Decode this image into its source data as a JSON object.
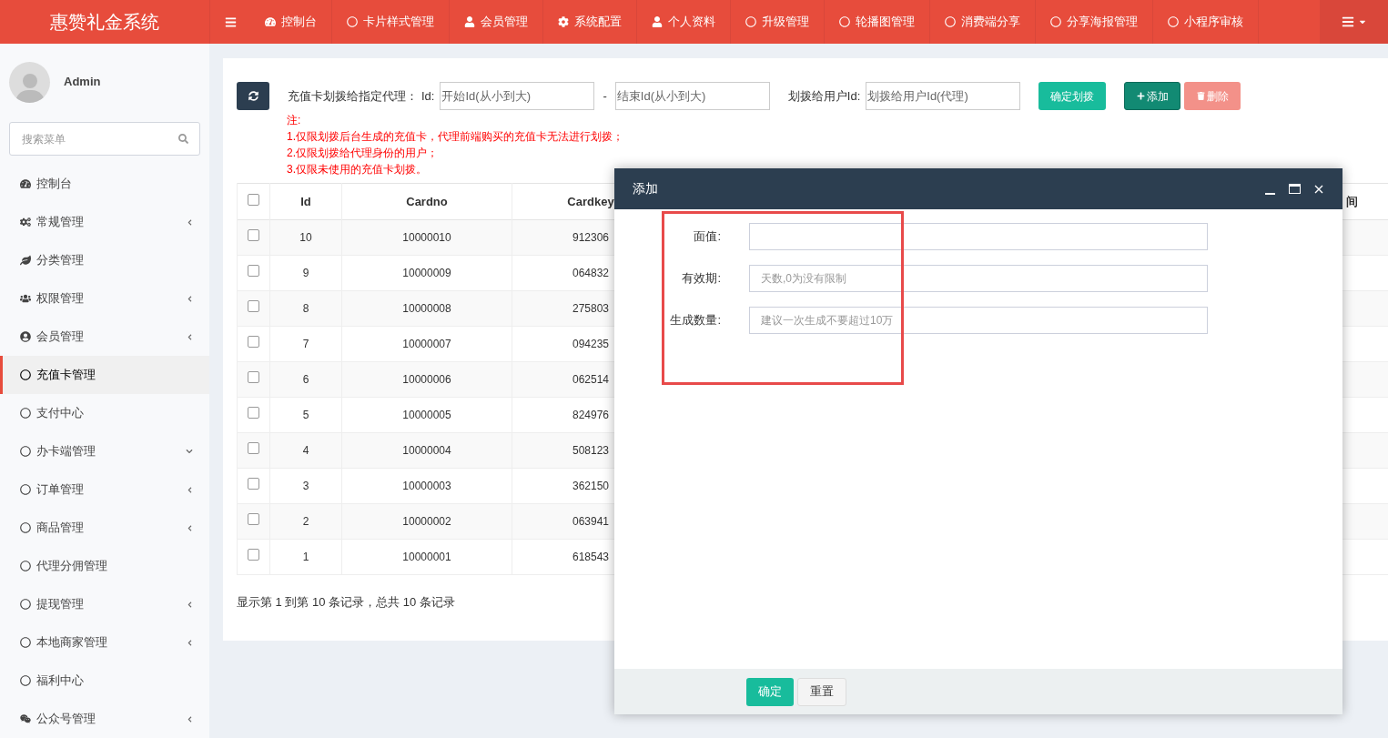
{
  "app_title": "惠赞礼金系统",
  "top_nav": [
    {
      "label": "控制台"
    },
    {
      "label": "卡片样式管理"
    },
    {
      "label": "会员管理"
    },
    {
      "label": "系统配置"
    },
    {
      "label": "个人资料"
    },
    {
      "label": "升级管理"
    },
    {
      "label": "轮播图管理"
    },
    {
      "label": "消费端分享"
    },
    {
      "label": "分享海报管理"
    },
    {
      "label": "小程序审核"
    }
  ],
  "user": {
    "name": "Admin"
  },
  "sidebar_search": {
    "placeholder": "搜索菜单"
  },
  "sidebar": {
    "items": [
      {
        "label": "控制台",
        "selected": false
      },
      {
        "label": "常规管理",
        "selected": false,
        "expanded": false
      },
      {
        "label": "分类管理",
        "selected": false
      },
      {
        "label": "权限管理",
        "selected": false,
        "expanded": false
      },
      {
        "label": "会员管理",
        "selected": false,
        "expanded": false
      },
      {
        "label": "充值卡管理",
        "selected": true
      },
      {
        "label": "支付中心",
        "selected": false
      },
      {
        "label": "办卡端管理",
        "selected": false,
        "expanded": true
      },
      {
        "label": "订单管理",
        "selected": false,
        "expanded": false
      },
      {
        "label": "商品管理",
        "selected": false,
        "expanded": false
      },
      {
        "label": "代理分佣管理",
        "selected": false
      },
      {
        "label": "提现管理",
        "selected": false,
        "expanded": false
      },
      {
        "label": "本地商家管理",
        "selected": false,
        "expanded": false
      },
      {
        "label": "福利中心",
        "selected": false
      },
      {
        "label": "公众号管理",
        "selected": false,
        "expanded": false
      }
    ]
  },
  "toolbar": {
    "transfer_label": "充值卡划拨给指定代理：",
    "id_label": "Id:",
    "start_placeholder": "开始Id(从小到大)",
    "separator": "-",
    "end_placeholder": "结束Id(从小到大)",
    "user_label": "划拨给用户Id:",
    "user_placeholder": "划拨给用户Id(代理)",
    "confirm_button": "确定划拨",
    "add_button": "添加",
    "delete_button": "删除"
  },
  "notes": [
    "注:",
    "1.仅限划拨后台生成的充值卡，代理前端购买的充值卡无法进行划拨；",
    "2.仅限划拨给代理身份的用户；",
    "3.仅限未使用的充值卡划拨。"
  ],
  "table": {
    "header_checked": false,
    "columns": [
      "Id",
      "Cardno",
      "Cardkey",
      "间"
    ],
    "rows": [
      {
        "id": "10",
        "cardno": "10000010",
        "cardkey": "912306",
        "checked": false
      },
      {
        "id": "9",
        "cardno": "10000009",
        "cardkey": "064832",
        "checked": false
      },
      {
        "id": "8",
        "cardno": "10000008",
        "cardkey": "275803",
        "checked": false
      },
      {
        "id": "7",
        "cardno": "10000007",
        "cardkey": "094235",
        "checked": false
      },
      {
        "id": "6",
        "cardno": "10000006",
        "cardkey": "062514",
        "checked": false
      },
      {
        "id": "5",
        "cardno": "10000005",
        "cardkey": "824976",
        "checked": false
      },
      {
        "id": "4",
        "cardno": "10000004",
        "cardkey": "508123",
        "checked": false
      },
      {
        "id": "3",
        "cardno": "10000003",
        "cardkey": "362150",
        "checked": false
      },
      {
        "id": "2",
        "cardno": "10000002",
        "cardkey": "063941",
        "checked": false
      },
      {
        "id": "1",
        "cardno": "10000001",
        "cardkey": "618543",
        "checked": false
      }
    ]
  },
  "pagination_info": "显示第 1 到第 10 条记录，总共 10 条记录",
  "dialog": {
    "title": "添加",
    "fields": [
      {
        "label": "面值:"
      },
      {
        "label": "有效期:",
        "placeholder": "天数,0为没有限制"
      },
      {
        "label": "生成数量:",
        "placeholder": "建议一次生成不要超过10万"
      }
    ],
    "buttons": [
      {
        "label": "确定",
        "kind": "primary"
      },
      {
        "label": "重置",
        "kind": "default"
      }
    ]
  }
}
